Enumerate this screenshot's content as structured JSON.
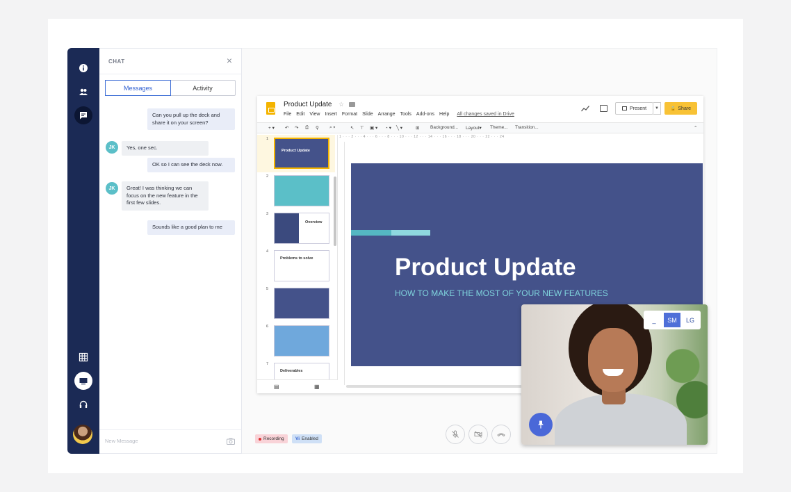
{
  "chat": {
    "title": "CHAT",
    "tabs": [
      "Messages",
      "Activity"
    ],
    "messages": [
      {
        "from": "me",
        "text": "Can you pull up the deck and share it on your screen?"
      },
      {
        "from": "JK",
        "text": "Yes, one sec."
      },
      {
        "from": "me",
        "text": "OK so I can see the deck now."
      },
      {
        "from": "JK",
        "text": "Great! I was thinking we can focus on the new feature in the first few slides."
      },
      {
        "from": "me",
        "text": "Sounds like a good plan to me"
      }
    ],
    "initials": "JK",
    "input_placeholder": "New Message"
  },
  "slides_app": {
    "doc_title": "Product Update",
    "menu": [
      "File",
      "Edit",
      "View",
      "Insert",
      "Format",
      "Slide",
      "Arrange",
      "Tools",
      "Add-ons",
      "Help"
    ],
    "saved_status": "All changes saved in Drive",
    "present_label": "Present",
    "share_label": "Share",
    "toolbar": {
      "background": "Background...",
      "layout": "Layout",
      "theme": "Theme...",
      "transition": "Transition..."
    },
    "ruler": "1 · · · 2 · · · 4 · · · 6 · · · 8 · · · 10 · · · 12 · · · 14 · · · 16 · · · 18 · · · 20 · · · 22 · · · 24",
    "thumbnails": [
      {
        "num": "1",
        "text": "Product Update"
      },
      {
        "num": "2",
        "text": ""
      },
      {
        "num": "3",
        "text": "Overview"
      },
      {
        "num": "4",
        "text": "Problems to solve"
      },
      {
        "num": "5",
        "text": ""
      },
      {
        "num": "6",
        "text": ""
      },
      {
        "num": "7",
        "text": "Deliverables"
      }
    ],
    "slide": {
      "title": "Product Update",
      "subtitle": "HOW TO MAKE THE MOST OF YOUR NEW FEATURES"
    }
  },
  "video": {
    "sizes": [
      "_",
      "SM",
      "LG"
    ],
    "selected_size": "SM"
  },
  "status": {
    "recording": "Recording",
    "vi": "Vi",
    "vi_enabled": "Enabled"
  }
}
